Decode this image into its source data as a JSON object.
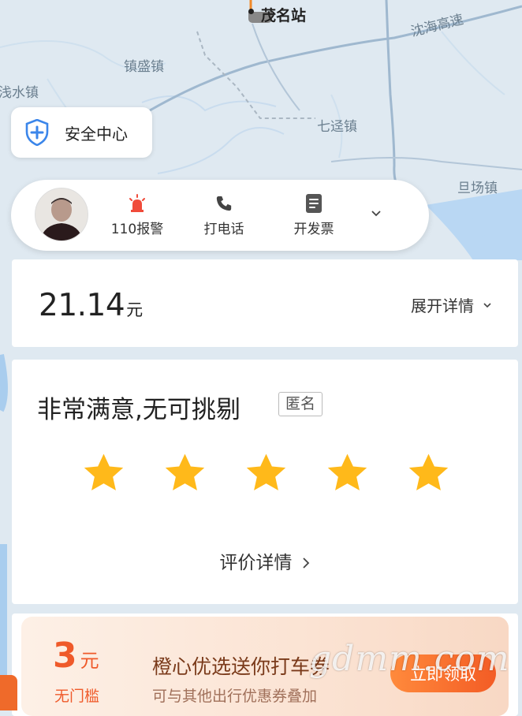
{
  "map": {
    "station": "茂名站",
    "labels": {
      "zhensheng": "镇盛镇",
      "qianshui": "浅水镇",
      "qijing": "七迳镇",
      "hanghai_expressway": "沈海高速",
      "danchang": "旦场镇"
    }
  },
  "safety": {
    "label": "安全中心",
    "icon": "shield-plus-icon"
  },
  "driver_bar": {
    "actions": [
      {
        "label": "110报警",
        "icon": "alarm-light-icon"
      },
      {
        "label": "打电话",
        "icon": "phone-icon"
      },
      {
        "label": "开发票",
        "icon": "invoice-icon"
      }
    ]
  },
  "fare": {
    "amount": "21.14",
    "unit": "元",
    "expand_label": "展开详情"
  },
  "rating": {
    "title": "非常满意,无可挑剔",
    "anonymous_tag": "匿名",
    "stars": 5,
    "max_stars": 5,
    "detail_link": "评价详情"
  },
  "coupon": {
    "amount": "3",
    "unit": "元",
    "threshold": "无门槛",
    "title": "橙心优选送你打车券",
    "desc": "可与其他出行优惠券叠加",
    "cta": "立即领取"
  },
  "watermark": "gdmm.com",
  "colors": {
    "star": "#ffb91a",
    "accent": "#ef5a2a",
    "shield": "#3b86ea",
    "alarm": "#f04b3a"
  }
}
